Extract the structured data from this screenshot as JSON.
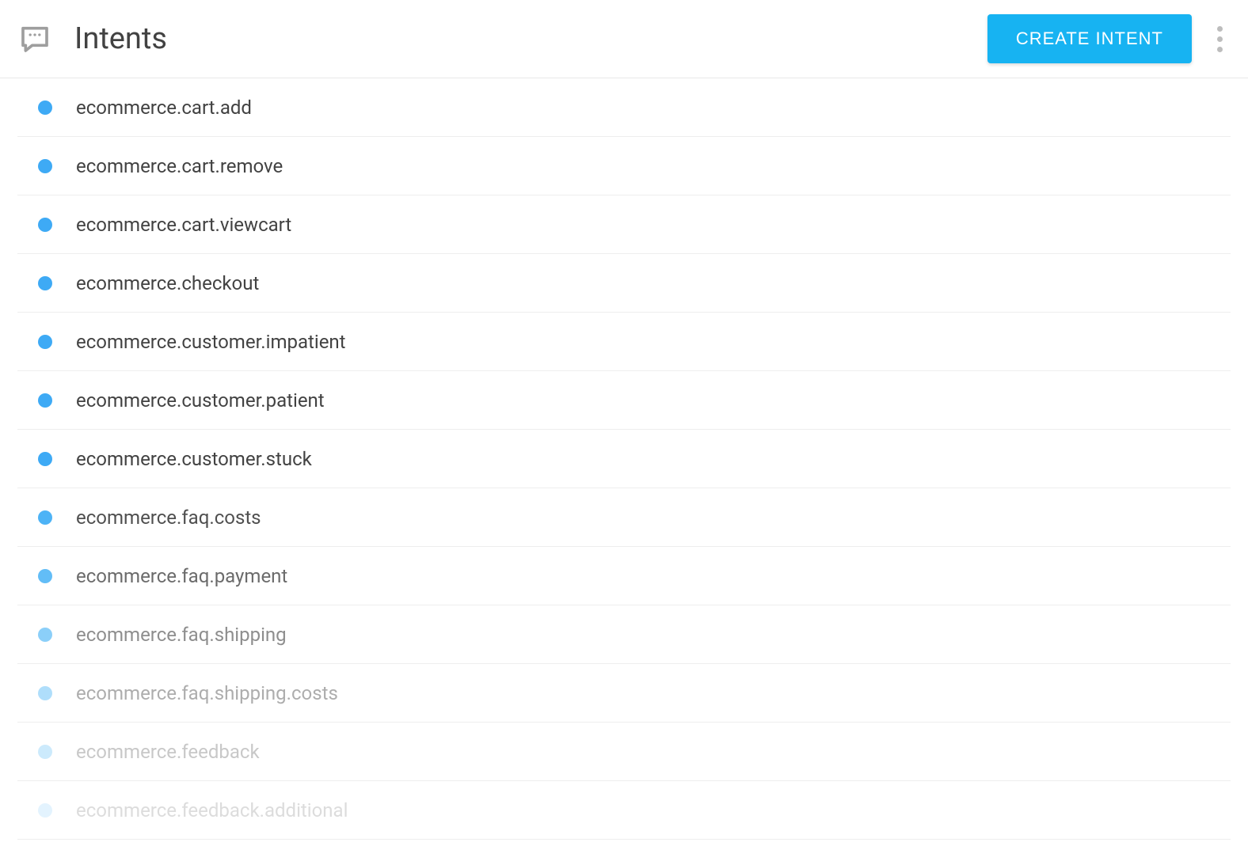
{
  "header": {
    "title": "Intents",
    "create_button": "CREATE INTENT"
  },
  "intents": [
    {
      "name": "ecommerce.cart.add",
      "fade": 0
    },
    {
      "name": "ecommerce.cart.remove",
      "fade": 0
    },
    {
      "name": "ecommerce.cart.viewcart",
      "fade": 0
    },
    {
      "name": "ecommerce.checkout",
      "fade": 0
    },
    {
      "name": "ecommerce.customer.impatient",
      "fade": 0
    },
    {
      "name": "ecommerce.customer.patient",
      "fade": 0
    },
    {
      "name": "ecommerce.customer.stuck",
      "fade": 0
    },
    {
      "name": "ecommerce.faq.costs",
      "fade": 1
    },
    {
      "name": "ecommerce.faq.payment",
      "fade": 2
    },
    {
      "name": "ecommerce.faq.shipping",
      "fade": 3
    },
    {
      "name": "ecommerce.faq.shipping.costs",
      "fade": 4
    },
    {
      "name": "ecommerce.feedback",
      "fade": 5
    },
    {
      "name": "ecommerce.feedback.additional",
      "fade": 6
    }
  ]
}
